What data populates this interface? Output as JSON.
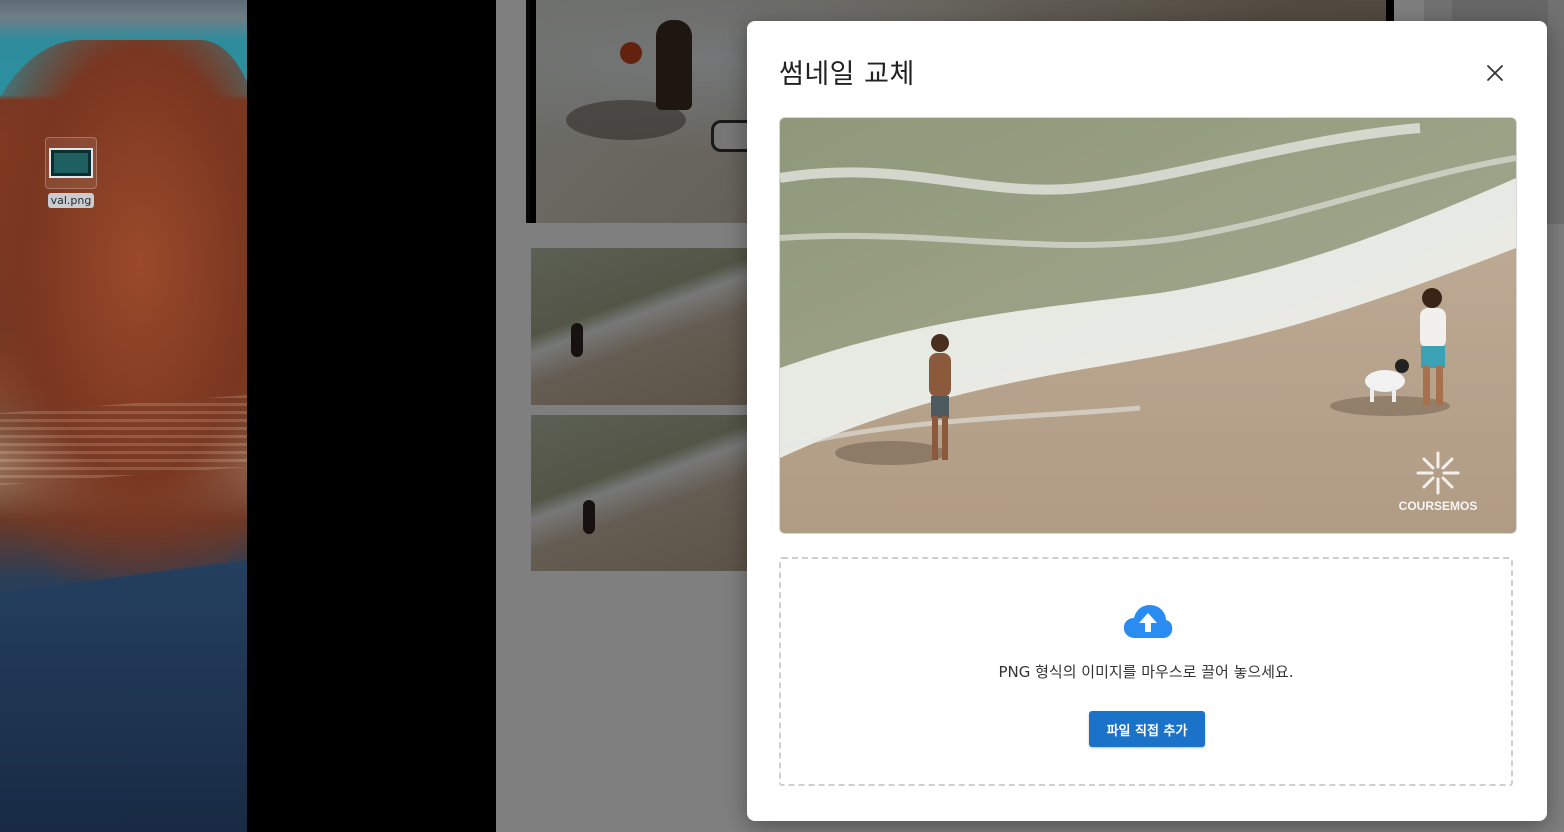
{
  "desktop": {
    "file_icon": {
      "name": "val.png"
    }
  },
  "modal": {
    "title": "썸네일 교체",
    "preview": {
      "watermark": "COURSEMOS"
    },
    "dropzone": {
      "instruction": "PNG 형식의 이미지를 마우스로 끌어 놓으세요.",
      "button_label": "파일 직접 추가"
    }
  },
  "colors": {
    "primary_button": "#1a72c9",
    "upload_icon": "#2a8cf0",
    "overlay": "rgba(0,0,0,0.5)"
  }
}
